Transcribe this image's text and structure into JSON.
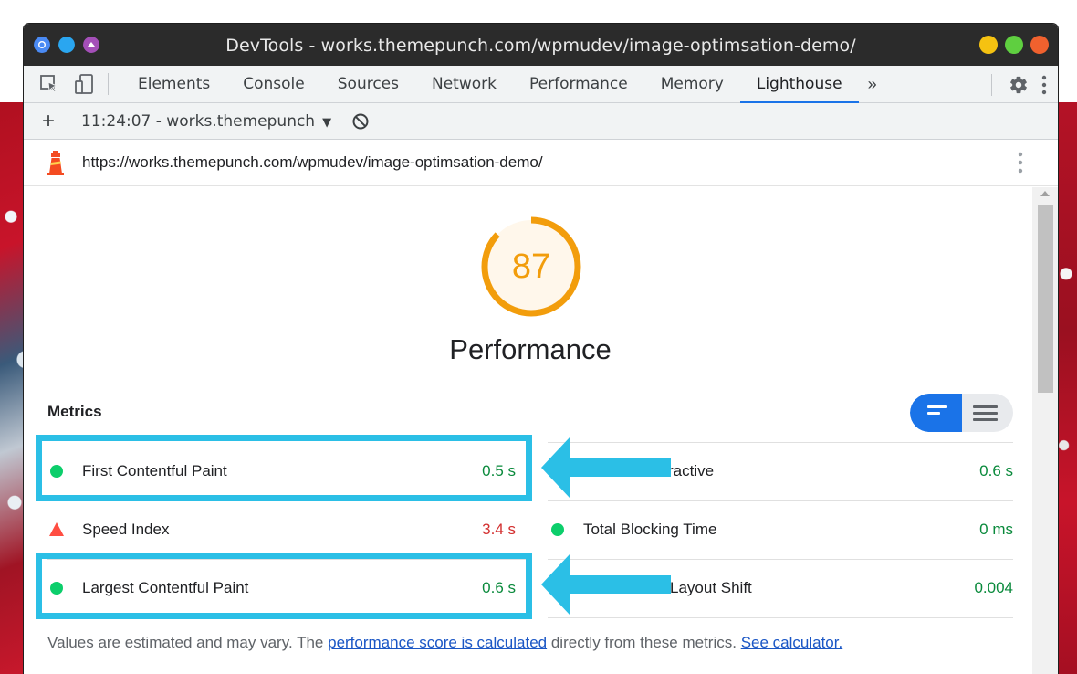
{
  "window": {
    "title": "DevTools - works.themepunch.com/wpmudev/image-optimsation-demo/"
  },
  "tabs": [
    "Elements",
    "Console",
    "Sources",
    "Network",
    "Performance",
    "Memory",
    "Lighthouse"
  ],
  "active_tab": "Lighthouse",
  "tabs_more": "»",
  "report_bar": {
    "add": "+",
    "selected_report": "11:24:07 - works.themepunch",
    "caret": "▼"
  },
  "url_bar": {
    "url": "https://works.themepunch.com/wpmudev/image-optimsation-demo/"
  },
  "gauge": {
    "score": "87",
    "score_fraction": 0.87,
    "title": "Performance",
    "color": "#f29d0c"
  },
  "metrics": {
    "label": "Metrics",
    "items": [
      {
        "name": "First Contentful Paint",
        "value": "0.5 s",
        "status": "pass"
      },
      {
        "name": "ractive",
        "value": "0.6 s",
        "status": "pass"
      },
      {
        "name": "Speed Index",
        "value": "3.4 s",
        "status": "fail"
      },
      {
        "name": "Total Blocking Time",
        "value": "0 ms",
        "status": "pass"
      },
      {
        "name": "Largest Contentful Paint",
        "value": "0.6 s",
        "status": "pass"
      },
      {
        "name": "Layout Shift",
        "value": "0.004",
        "status": "pass"
      }
    ]
  },
  "footnote": {
    "prefix": "Values are estimated and may vary. The ",
    "link1": "performance score is calculated",
    "middle": " directly from these metrics. ",
    "link2": "See calculator."
  },
  "colors": {
    "pass": "#0cce6b",
    "pass_text": "#0a8a3c",
    "fail": "#ff4e42",
    "fail_text": "#d32f2f",
    "highlight": "#2bbfe6",
    "accent": "#1a73e8"
  }
}
